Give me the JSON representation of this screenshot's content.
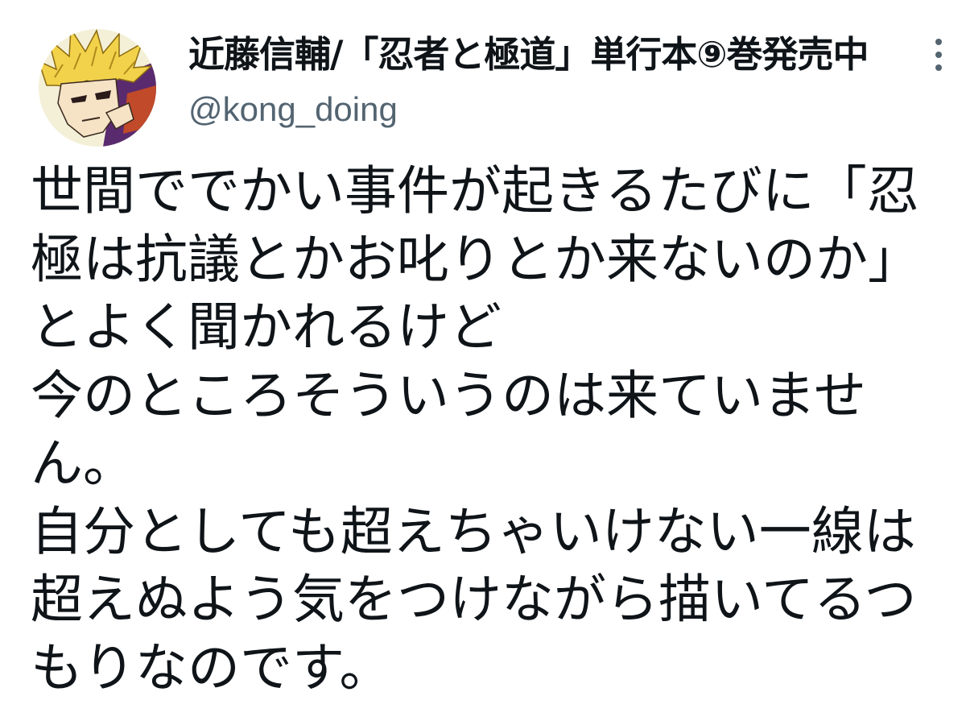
{
  "tweet": {
    "author": {
      "display_name": "近藤信輔/「忍者と極道」単行本⑨巻発売中",
      "handle": "@kong_doing",
      "avatar": "manga-character-avatar"
    },
    "more_icon": "more-vertical-icon",
    "text_lines": [
      "世間ででかい事件が起きるたびに「忍",
      "極は抗議とかお叱りとか来ないのか」",
      "とよく聞かれるけど",
      "今のところそういうのは来ていませ",
      "ん。",
      "自分としても超えちゃいけない一線は",
      "超えぬよう気をつけながら描いてるつ",
      "もりなのです。"
    ]
  }
}
